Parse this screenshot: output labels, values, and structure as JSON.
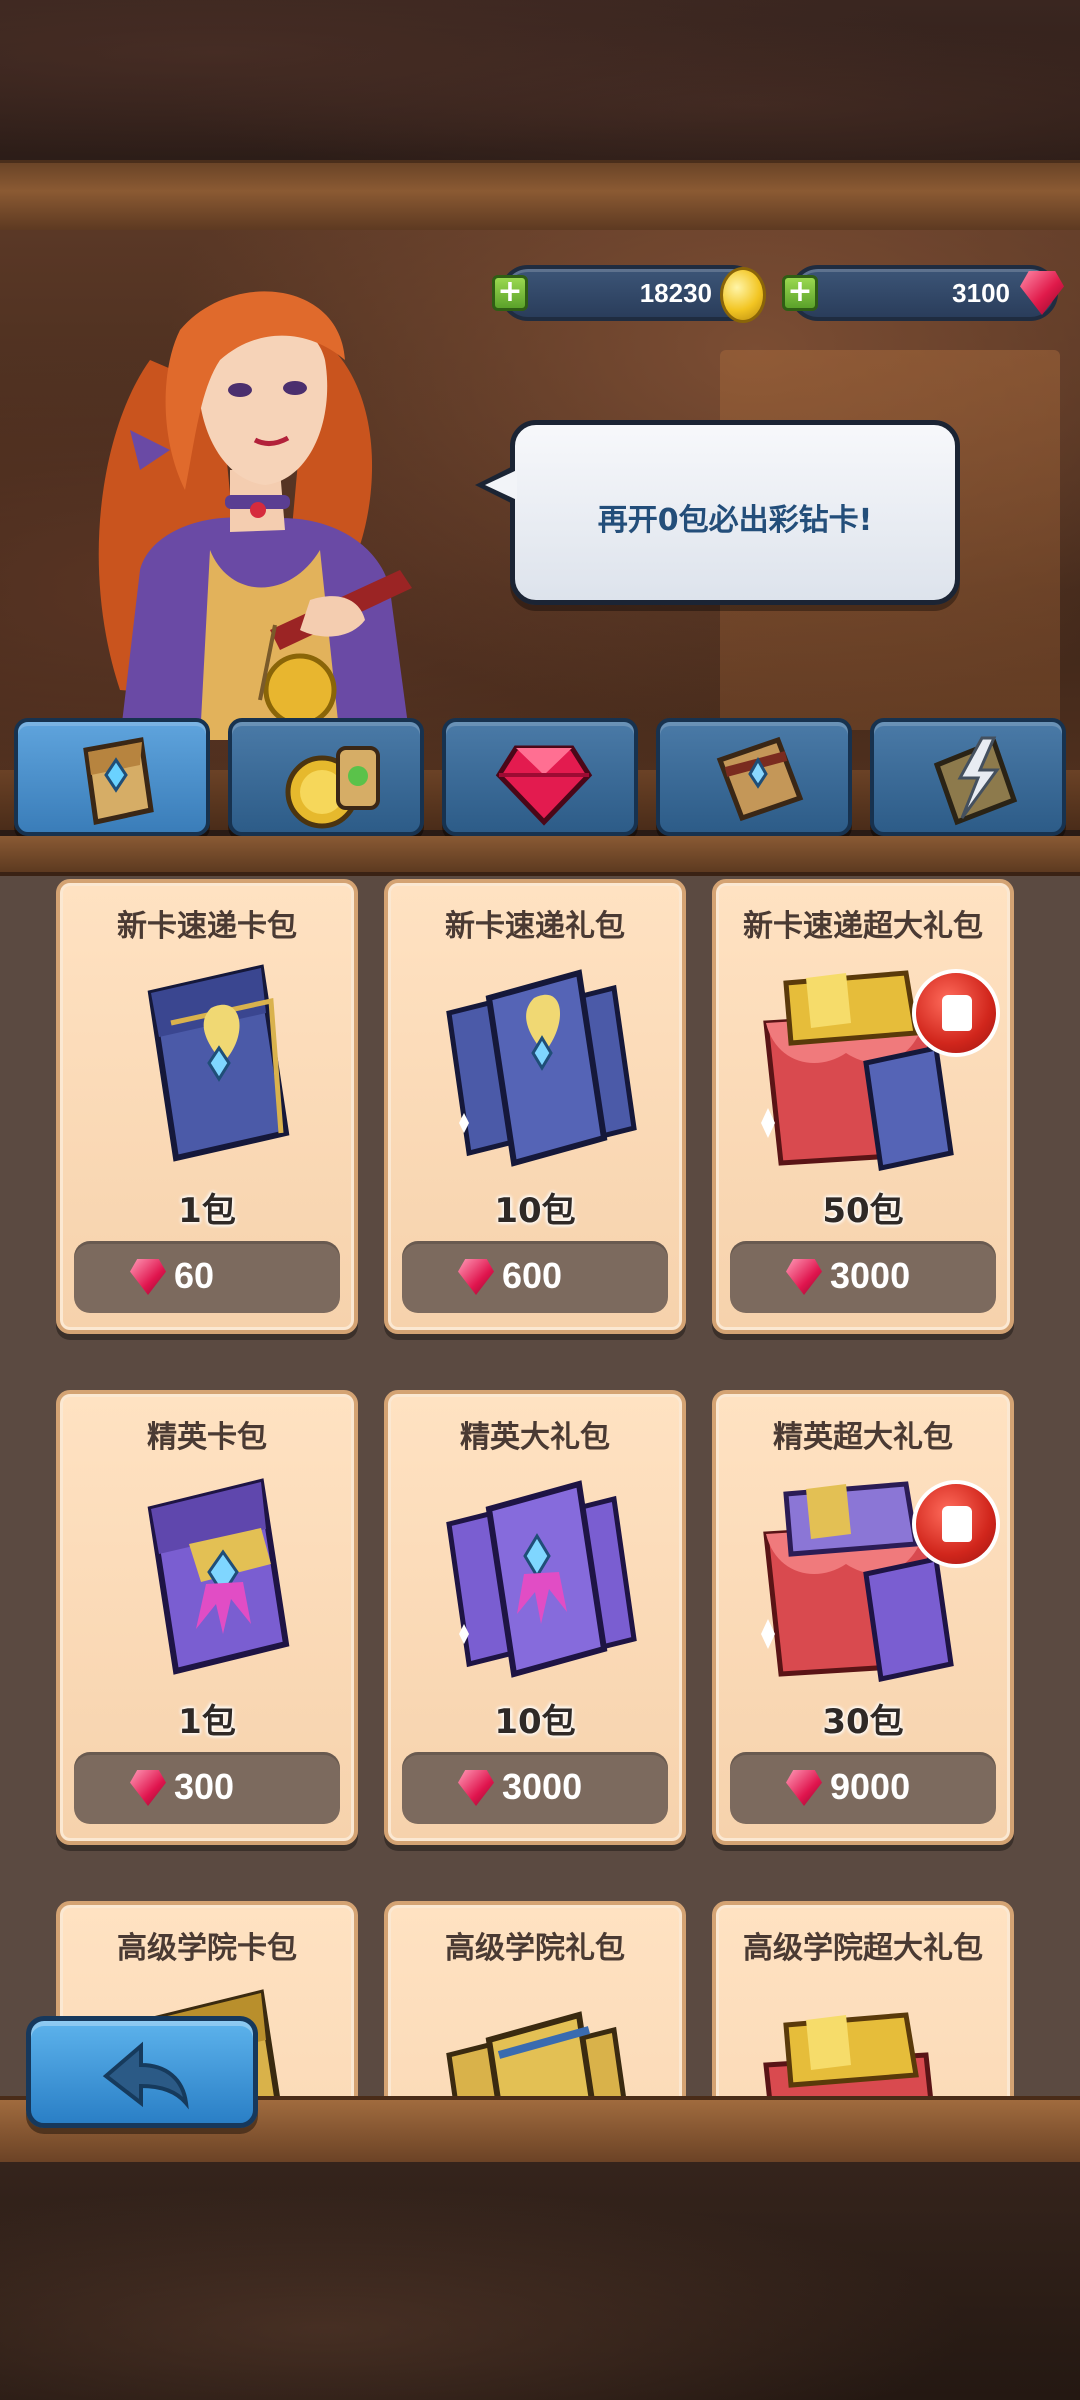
{
  "currency": {
    "gold": "18230",
    "gems": "3100",
    "add_gold_label": "+",
    "add_gems_label": "+"
  },
  "npc": {
    "speech": "再开0包必出彩钻卡!"
  },
  "tabs": [
    {
      "icon": "card-pack-icon",
      "active": true
    },
    {
      "icon": "gold-coin-pack-icon",
      "active": false
    },
    {
      "icon": "ruby-gem-icon",
      "active": false
    },
    {
      "icon": "spell-book-icon",
      "active": false
    },
    {
      "icon": "lightning-book-icon",
      "active": false
    }
  ],
  "cards": [
    {
      "title": "新卡速递卡包",
      "qty": "1包",
      "price": "60",
      "style": "blue-pack",
      "badge": false
    },
    {
      "title": "新卡速递礼包",
      "qty": "10包",
      "price": "600",
      "style": "blue-pack-stack",
      "badge": false
    },
    {
      "title": "新卡速递超大礼包",
      "qty": "50包",
      "price": "3000",
      "style": "gold-chest",
      "badge": true
    },
    {
      "title": "精英卡包",
      "qty": "1包",
      "price": "300",
      "style": "purple-pack",
      "badge": false
    },
    {
      "title": "精英大礼包",
      "qty": "10包",
      "price": "3000",
      "style": "purple-pack-stack",
      "badge": false
    },
    {
      "title": "精英超大礼包",
      "qty": "30包",
      "price": "9000",
      "style": "gold-chest",
      "badge": true
    },
    {
      "title": "高级学院卡包",
      "qty": "",
      "price": "",
      "style": "gold-pack",
      "badge": false
    },
    {
      "title": "高级学院礼包",
      "qty": "",
      "price": "",
      "style": "gold-pack-stack",
      "badge": false
    },
    {
      "title": "高级学院超大礼包",
      "qty": "",
      "price": "",
      "style": "gold-chest",
      "badge": false
    }
  ],
  "colors": {
    "card_bg": "#f6d2ac",
    "price_bg": "#7c6a5e",
    "tab_bg": "#2d5c88",
    "speech_text": "#234e7a"
  }
}
